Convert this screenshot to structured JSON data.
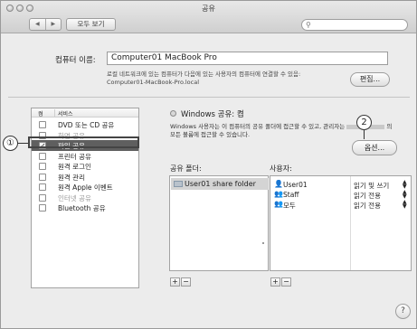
{
  "window": {
    "title": "공유"
  },
  "toolbar": {
    "back": "◀",
    "forward": "▶",
    "show_all": "모두 보기",
    "search_placeholder": ""
  },
  "computer": {
    "label": "컴퓨터 이름:",
    "name": "Computer01 MacBook Pro",
    "desc_line1": "로컬 네트워크에 있는 컴퓨터가 다음에 있는 사용자의 컴퓨터에 연결할 수 있음:",
    "desc_line2": "Computer01-MacBook-Pro.local",
    "edit_button": "편집..."
  },
  "services": {
    "header_on": "켬",
    "header_service": "서비스",
    "items": [
      {
        "label": "DVD 또는 CD 공유",
        "checked": false
      },
      {
        "label": "화면 공유",
        "checked": false
      },
      {
        "label": "파일 공유",
        "checked": true
      },
      {
        "label": "프린터 공유",
        "checked": false
      },
      {
        "label": "원격 로그인",
        "checked": false
      },
      {
        "label": "원격 관리",
        "checked": false
      },
      {
        "label": "원격 Apple 이벤트",
        "checked": false
      },
      {
        "label": "인터넷 공유",
        "checked": false
      },
      {
        "label": "Bluetooth 공유",
        "checked": false
      }
    ]
  },
  "status": {
    "title": "Windows 공유: 켬",
    "desc_line1": "Windows 사용자는 이 컴퓨터의 공유 폴더에 접근할 수 있고, 관리자는",
    "desc_line1_end": "의",
    "desc_line2": "모든 볼륨에 접근할 수 있습니다.",
    "options_button": "옵션..."
  },
  "folders": {
    "label": "공유 폴더:",
    "items": [
      "User01 share folder"
    ],
    "add": "+",
    "remove": "−"
  },
  "users": {
    "label": "사용자:",
    "items": [
      {
        "name": "User01",
        "permission": "읽기 및 쓰기"
      },
      {
        "name": "Staff",
        "permission": "읽기 전용"
      },
      {
        "name": "모두",
        "permission": "읽기 전용"
      }
    ],
    "add": "+",
    "remove": "−"
  },
  "help": "?",
  "callouts": {
    "one": "①",
    "two": "2"
  }
}
